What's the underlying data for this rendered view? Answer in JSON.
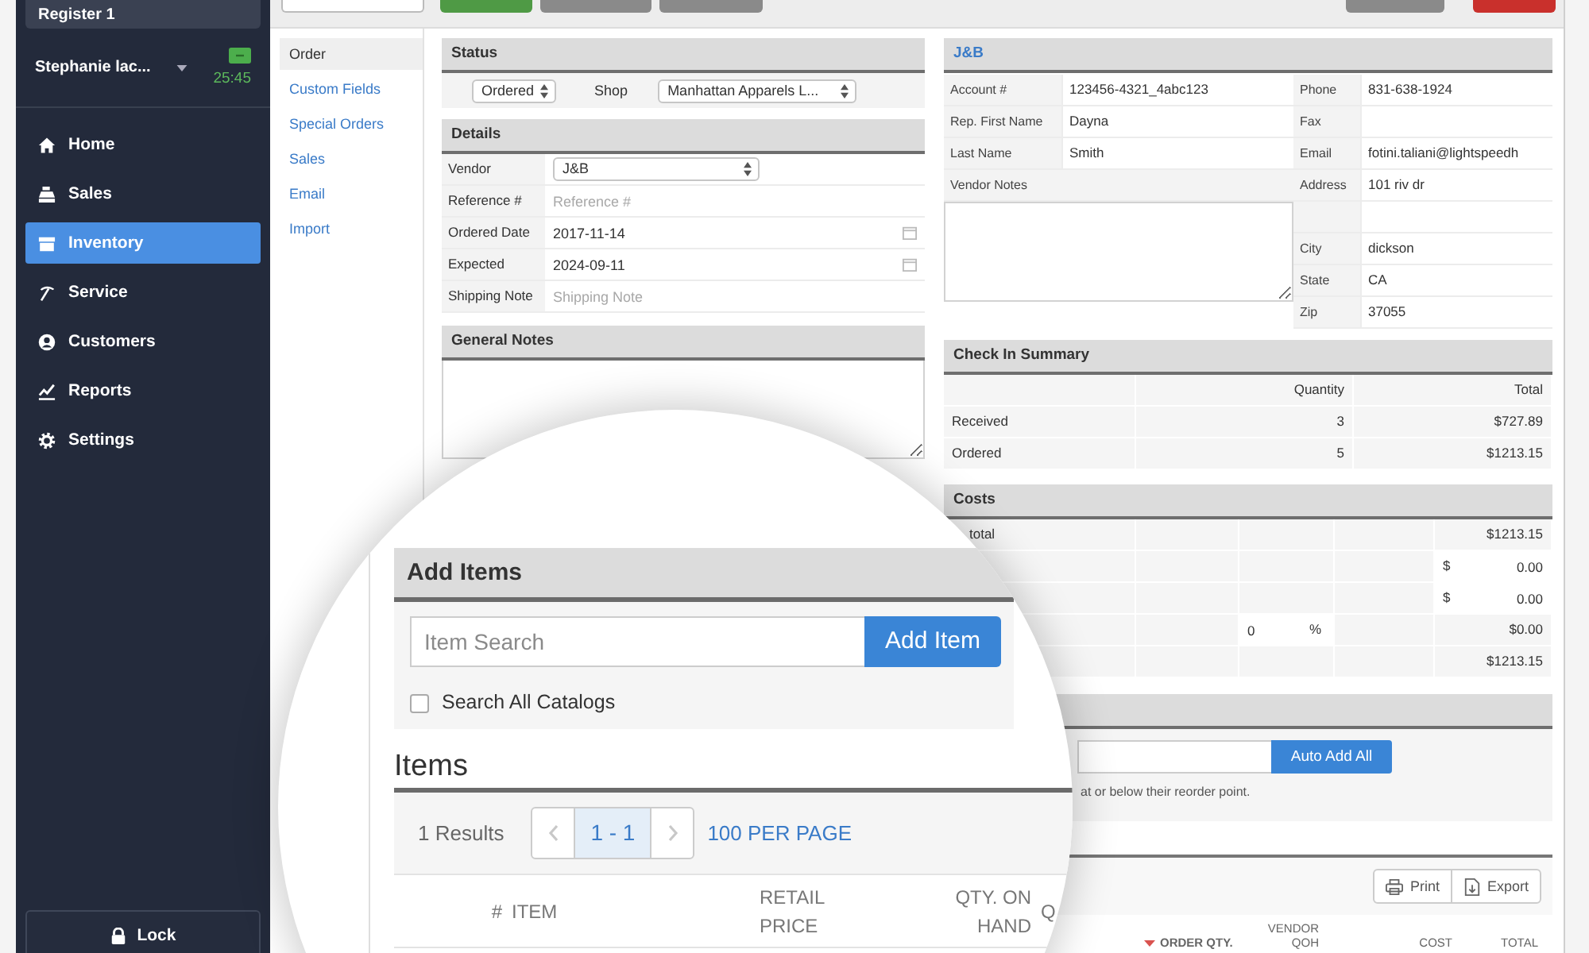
{
  "toolbar": {
    "left_buttons": [
      {
        "kind": "outline"
      },
      {
        "kind": "success"
      },
      {
        "kind": "secondary"
      },
      {
        "kind": "secondary"
      }
    ],
    "right_buttons": [
      {
        "kind": "secondary"
      },
      {
        "kind": "danger"
      }
    ]
  },
  "sidebar": {
    "register": "Register 1",
    "user": "Stephanie lac...",
    "timer": "25:45",
    "nav": [
      {
        "label": "Home",
        "selected": false
      },
      {
        "label": "Sales",
        "selected": false
      },
      {
        "label": "Inventory",
        "selected": true
      },
      {
        "label": "Service",
        "selected": false
      },
      {
        "label": "Customers",
        "selected": false
      },
      {
        "label": "Reports",
        "selected": false
      },
      {
        "label": "Settings",
        "selected": false
      }
    ],
    "lock": "Lock"
  },
  "subnav": [
    {
      "label": "Order",
      "selected": true
    },
    {
      "label": "Custom Fields",
      "selected": false
    },
    {
      "label": "Special Orders",
      "selected": false
    },
    {
      "label": "Sales",
      "selected": false
    },
    {
      "label": "Email",
      "selected": false
    },
    {
      "label": "Import",
      "selected": false
    }
  ],
  "status": {
    "title": "Status",
    "status_value": "Ordered",
    "shop_label": "Shop",
    "shop_value": "Manhattan Apparels L..."
  },
  "details": {
    "title": "Details",
    "rows": [
      {
        "kind": "select",
        "label": "Vendor",
        "value": "J&B"
      },
      {
        "kind": "text",
        "label": "Reference #",
        "placeholder": "Reference #"
      },
      {
        "kind": "date",
        "label": "Ordered Date",
        "value": "2017-11-14"
      },
      {
        "kind": "date",
        "label": "Expected",
        "value": "2024-09-11"
      },
      {
        "kind": "text",
        "label": "Shipping Note",
        "placeholder": "Shipping Note"
      }
    ]
  },
  "general_notes": {
    "title": "General Notes"
  },
  "vendor": {
    "title": "J&B",
    "fields": [
      {
        "label": "Account #",
        "value": "123456-4321_4abc123"
      },
      {
        "label": "Rep. First Name",
        "value": "Dayna"
      },
      {
        "label": "Last Name",
        "value": "Smith"
      }
    ],
    "notes_label": "Vendor Notes",
    "contact": [
      {
        "kind": "field",
        "label": "Phone",
        "value": "831-638-1924"
      },
      {
        "kind": "field",
        "label": "Fax"
      },
      {
        "kind": "field",
        "label": "Email",
        "value": "fotini.taliani@lightspeedh"
      },
      {
        "kind": "field",
        "label": "Address",
        "value": "101 riv dr"
      },
      {
        "kind": "blank"
      },
      {
        "kind": "field",
        "label": "City",
        "value": "dickson"
      },
      {
        "kind": "field",
        "label": "State",
        "value": "CA"
      },
      {
        "kind": "field",
        "label": "Zip",
        "value": "37055"
      }
    ]
  },
  "check_in": {
    "title": "Check In Summary",
    "columns": [
      "Quantity",
      "Total"
    ],
    "rows": [
      {
        "label": "Received",
        "quantity": "3",
        "total": "$727.89"
      },
      {
        "label": "Ordered",
        "quantity": "5",
        "total": "$1213.15"
      }
    ]
  },
  "costs": {
    "title": "Costs",
    "rows": [
      {
        "kind": "plain",
        "label": "total",
        "value": "$1213.15"
      },
      {
        "kind": "amount",
        "currency": "$",
        "value": "0.00"
      },
      {
        "kind": "amount",
        "currency": "$",
        "value": "0.00"
      },
      {
        "kind": "percent",
        "percent": "0",
        "unit": "%",
        "value": "$0.00"
      },
      {
        "kind": "plain",
        "value": "$1213.15"
      }
    ]
  },
  "reorder": {
    "button": "Auto Add All",
    "note": "at or below their reorder point."
  },
  "order_items": {
    "actions": [
      {
        "kind": "print",
        "label": "Print"
      },
      {
        "kind": "export",
        "label": "Export"
      }
    ],
    "columns": [
      {
        "label": "ORDER QTY.",
        "sorted": true
      },
      {
        "label": "VENDOR QOH",
        "sorted": false
      },
      {
        "label": "COST",
        "sorted": false
      },
      {
        "label": "TOTAL",
        "sorted": false
      }
    ]
  },
  "magnifier": {
    "add_items": {
      "title": "Add Items",
      "search_placeholder": "Item Search",
      "button": "Add Item",
      "search_all": {
        "label": "Search All Catalogs",
        "checked": false
      }
    },
    "items": {
      "title": "Items",
      "results": "1 Results",
      "previous": {
        "disabled": true
      },
      "page": "1 - 1",
      "next": {
        "disabled": true
      },
      "per_page": "100 PER PAGE",
      "columns": [
        "#",
        "ITEM",
        "RETAIL PRICE",
        "QTY. ON HAND",
        "Q"
      ]
    }
  }
}
